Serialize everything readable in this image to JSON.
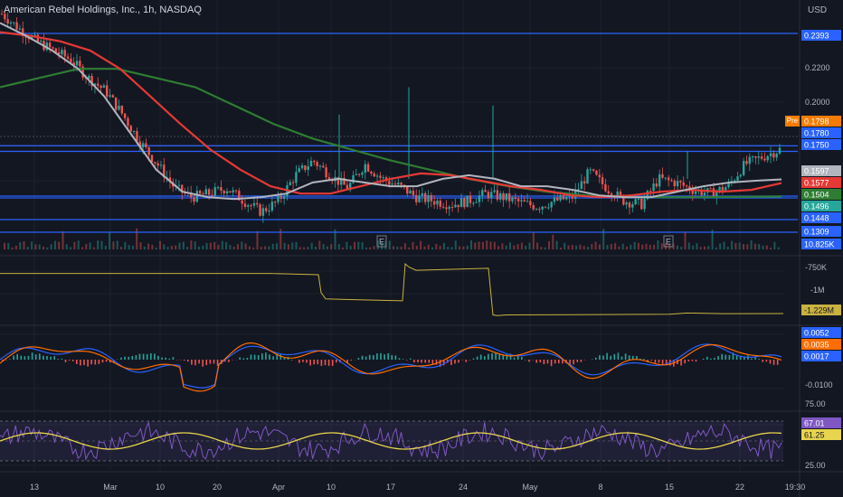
{
  "header": {
    "symbol_title": "American Rebel Holdings, Inc., 1h, NASDAQ",
    "currency": "USD",
    "pre_label": "Pre"
  },
  "colors": {
    "background": "#131722",
    "up": "#26a69a",
    "down": "#ef5350",
    "ma_fast": "#b2b5be",
    "ma_mid": "#e53935",
    "ma_slow": "#2e7d32",
    "hline": "#2962ff",
    "obv": "#c9b23f",
    "macd": "#2962ff",
    "signal": "#ff6d00",
    "rsi": "#7e57c2",
    "rsi_ma": "#e8d44d"
  },
  "chart_data": [
    {
      "type": "line",
      "name": "price",
      "x": [
        "13",
        "Mar",
        "10",
        "20",
        "Apr",
        "10",
        "17",
        "24",
        "May",
        "8",
        "15",
        "22",
        "19:30"
      ],
      "price_path": [
        0.25,
        0.242,
        0.235,
        0.23,
        0.225,
        0.215,
        0.208,
        0.195,
        0.18,
        0.168,
        0.155,
        0.15,
        0.152,
        0.155,
        0.148,
        0.142,
        0.148,
        0.162,
        0.17,
        0.162,
        0.155,
        0.168,
        0.16,
        0.156,
        0.15,
        0.148,
        0.146,
        0.148,
        0.152,
        0.15,
        0.147,
        0.145,
        0.148,
        0.15,
        0.164,
        0.155,
        0.148,
        0.146,
        0.16,
        0.158,
        0.154,
        0.152,
        0.156,
        0.168,
        0.172,
        0.176
      ],
      "ma_fast": [
        0.245,
        0.238,
        0.23,
        0.22,
        0.205,
        0.185,
        0.165,
        0.153,
        0.15,
        0.149,
        0.15,
        0.152,
        0.158,
        0.16,
        0.158,
        0.156,
        0.156,
        0.16,
        0.162,
        0.16,
        0.156,
        0.156,
        0.154,
        0.151,
        0.15,
        0.15,
        0.153,
        0.156,
        0.158,
        0.159,
        0.1597
      ],
      "ma_mid": [
        0.24,
        0.238,
        0.235,
        0.23,
        0.22,
        0.205,
        0.19,
        0.176,
        0.165,
        0.156,
        0.152,
        0.152,
        0.156,
        0.16,
        0.163,
        0.162,
        0.159,
        0.156,
        0.154,
        0.151,
        0.15,
        0.151,
        0.153,
        0.154,
        0.153,
        0.154,
        0.1577
      ],
      "ma_slow": [
        0.21,
        0.215,
        0.22,
        0.22,
        0.215,
        0.21,
        0.2,
        0.19,
        0.182,
        0.176,
        0.17,
        0.165,
        0.16,
        0.156,
        0.153,
        0.151,
        0.15,
        0.15,
        0.15,
        0.1502,
        0.1504
      ],
      "hlines": [
        0.2393,
        0.178,
        0.175,
        0.1496,
        0.1309
      ],
      "price_ticks": [
        "0.2200",
        "0.2000"
      ],
      "tags": [
        {
          "label": "0.2393",
          "color": "#2962ff"
        },
        {
          "label": "0.1798",
          "color": "#f57c00"
        },
        {
          "label": "0.1780",
          "color": "#2962ff"
        },
        {
          "label": "0.1750",
          "color": "#2962ff"
        },
        {
          "label": "0.1597",
          "color": "#b2b5be"
        },
        {
          "label": "0.1577",
          "color": "#e53935"
        },
        {
          "label": "0.1504",
          "color": "#2e7d32"
        },
        {
          "label": "0.1496",
          "color": "#26a69a"
        },
        {
          "label": "0.1448",
          "color": "#2962ff"
        },
        {
          "label": "0.1309",
          "color": "#2962ff"
        },
        {
          "label": "10.825K",
          "color": "#2962ff"
        }
      ],
      "earnings_marker": "E"
    },
    {
      "type": "line",
      "name": "obv",
      "y_ticks": [
        "-750K",
        "-1M"
      ],
      "tag": "-1.229M",
      "values": [
        -0.62,
        -0.62,
        -0.62,
        -0.62,
        -0.62,
        -0.62,
        -0.6,
        -1.0,
        -1.05,
        -0.45,
        -0.6,
        -1.25,
        -1.25,
        -1.24,
        -1.25,
        -1.23,
        -1.22,
        -1.229
      ]
    },
    {
      "type": "bar",
      "name": "macd",
      "y_ticks": [
        "-0.0100"
      ],
      "tags": [
        "0.0052",
        "0.0035",
        "0.0017"
      ]
    },
    {
      "type": "line",
      "name": "rsi",
      "y_ticks": [
        "75.00",
        "25.00"
      ],
      "tags": [
        "67.01",
        "61.25"
      ]
    }
  ]
}
